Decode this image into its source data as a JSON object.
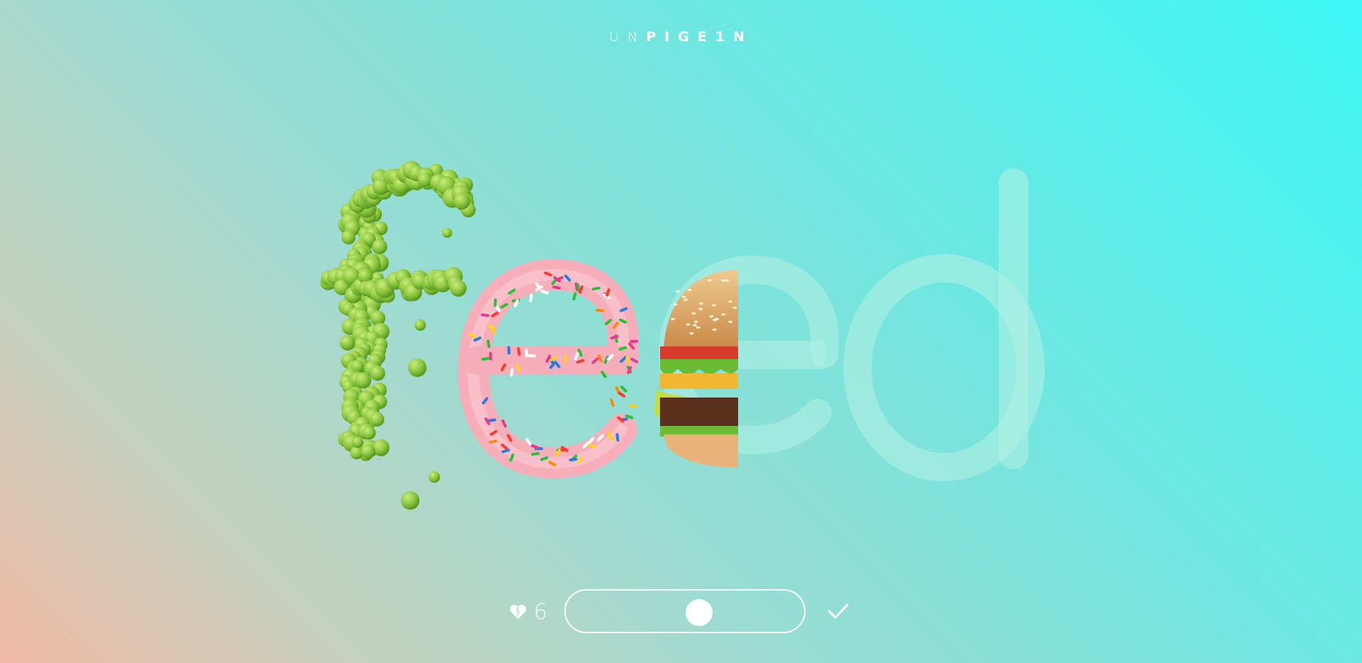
{
  "brand": {
    "light": "UN",
    "bold": "PIGE1N"
  },
  "puzzle": {
    "word_letters": [
      "f",
      "e",
      "e",
      "d"
    ],
    "fill_materials": [
      "peas",
      "donut",
      "burger",
      "empty"
    ],
    "reveal_fraction": 0.39
  },
  "lives": {
    "icon": "heart-icon",
    "count": "6"
  },
  "slider": {
    "value_fraction": 0.56
  },
  "confirm": {
    "icon": "check-icon"
  },
  "colors": {
    "bg_top_right": "#3cf6f6",
    "bg_bottom_left": "#f0b9a5",
    "peas": "#8dc63f",
    "donut": "#f6aebb",
    "ghost_letter": "#b4f0e4",
    "ui": "#ffffff"
  }
}
